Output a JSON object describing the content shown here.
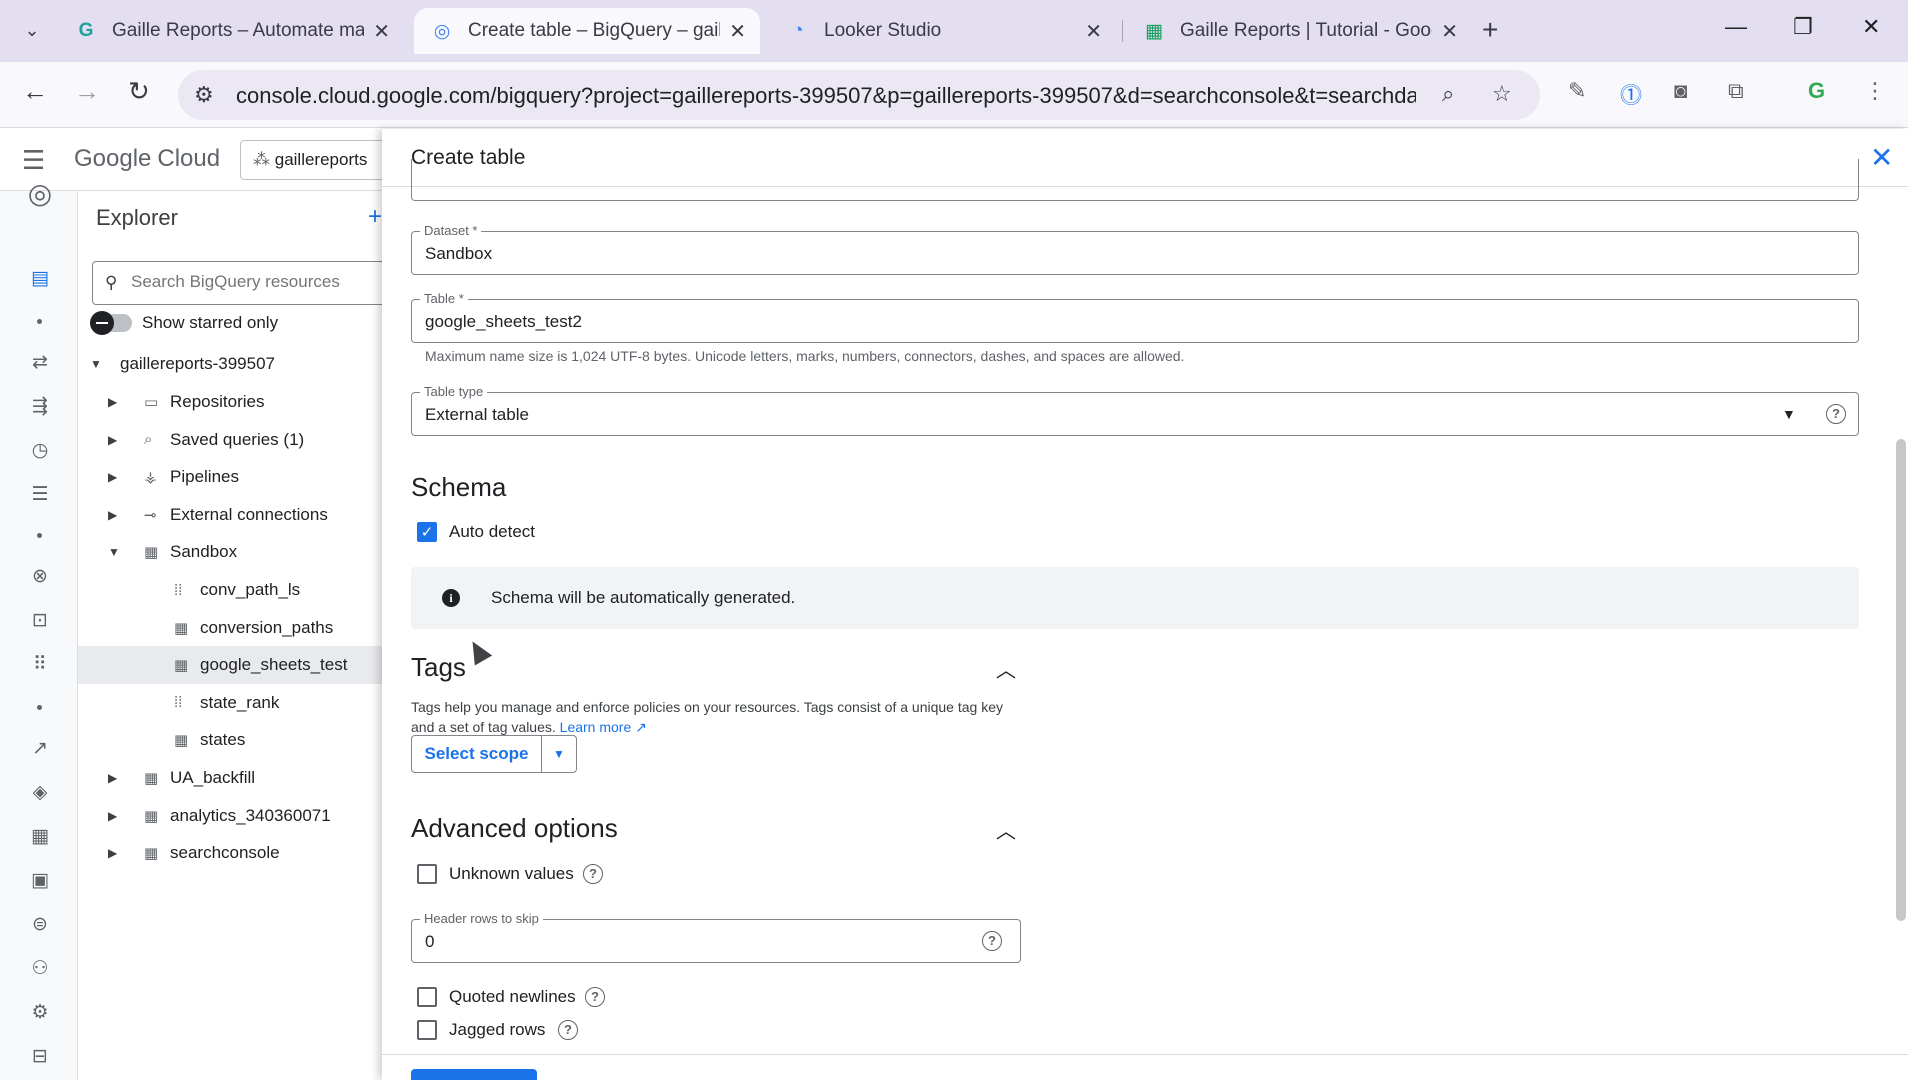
{
  "browser": {
    "tabs": [
      {
        "title": "Gaille Reports – Automate mark",
        "icon": "gaille-reports-icon"
      },
      {
        "title": "Create table – BigQuery – gaille",
        "icon": "bigquery-icon",
        "active": true
      },
      {
        "title": "Looker Studio",
        "icon": "looker-studio-icon"
      },
      {
        "title": "Gaille Reports | Tutorial - Goog",
        "icon": "google-sheets-icon"
      }
    ],
    "url": "console.cloud.google.com/bigquery?project=gaillereports-399507&p=gaillereports-399507&d=searchconsole&t=searchdata_si..."
  },
  "gcp": {
    "logo_google": "Google",
    "logo_cloud": "Cloud",
    "project": "gaillereports"
  },
  "explorer": {
    "title": "Explorer",
    "search_placeholder": "Search BigQuery resources",
    "starred_label": "Show starred only",
    "project": "gaillereports-399507",
    "items": [
      {
        "label": "Repositories",
        "icon": "repository-icon",
        "level": 1,
        "arrow": "▶"
      },
      {
        "label": "Saved queries (1)",
        "icon": "saved-query-icon",
        "level": 1,
        "arrow": "▶"
      },
      {
        "label": "Pipelines",
        "icon": "pipeline-icon",
        "level": 1,
        "arrow": "▶"
      },
      {
        "label": "External connections",
        "icon": "connection-icon",
        "level": 1,
        "arrow": "▶"
      },
      {
        "label": "Sandbox",
        "icon": "dataset-icon",
        "level": 1,
        "arrow": "▼"
      },
      {
        "label": "conv_path_ls",
        "icon": "external-table-icon",
        "level": 2,
        "arrow": ""
      },
      {
        "label": "conversion_paths",
        "icon": "table-icon",
        "level": 2,
        "arrow": ""
      },
      {
        "label": "google_sheets_test",
        "icon": "table-icon",
        "level": 2,
        "arrow": "",
        "selected": true
      },
      {
        "label": "state_rank",
        "icon": "external-table-icon",
        "level": 2,
        "arrow": ""
      },
      {
        "label": "states",
        "icon": "table-icon",
        "level": 2,
        "arrow": ""
      },
      {
        "label": "UA_backfill",
        "icon": "dataset-icon",
        "level": 1,
        "arrow": "▶"
      },
      {
        "label": "analytics_340360071",
        "icon": "dataset-icon",
        "level": 1,
        "arrow": "▶"
      },
      {
        "label": "searchconsole",
        "icon": "dataset-icon",
        "level": 1,
        "arrow": "▶"
      }
    ]
  },
  "panel": {
    "title": "Create table",
    "dataset_label": "Dataset *",
    "dataset_value": "Sandbox",
    "table_label": "Table *",
    "table_value": "google_sheets_test2",
    "table_hint": "Maximum name size is 1,024 UTF-8 bytes. Unicode letters, marks, numbers, connectors, dashes, and spaces are allowed.",
    "table_type_label": "Table type",
    "table_type_value": "External table",
    "schema_title": "Schema",
    "auto_detect_label": "Auto detect",
    "auto_detect_checked": true,
    "schema_info": "Schema will be automatically generated.",
    "tags_title": "Tags",
    "tags_desc": "Tags help you manage and enforce policies on your resources. Tags consist of a unique tag key and a set of tag values.",
    "tags_learn_more": "Learn more",
    "select_scope_label": "Select scope",
    "advanced_title": "Advanced options",
    "unknown_values_label": "Unknown values",
    "header_rows_label": "Header rows to skip",
    "header_rows_value": "0",
    "quoted_newlines_label": "Quoted newlines",
    "jagged_rows_label": "Jagged rows"
  }
}
